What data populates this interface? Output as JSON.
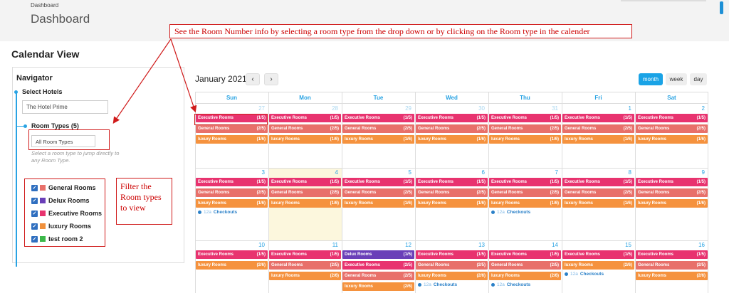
{
  "header": {
    "breadcrumb": "Dashboard",
    "title": "Dashboard"
  },
  "callouts": {
    "top": "See the Room Number info by selecting a room type from the drop down or by clicking on the Room type in the calender",
    "side": "Filter the Room types to view"
  },
  "calendar_view": {
    "title": "Calendar View"
  },
  "navigator": {
    "title": "Navigator",
    "select_hotels_label": "Select Hotels",
    "hotel_value": "The Hotel Prime",
    "room_types_label": "Room Types (5)",
    "room_types_select": "All Room Types",
    "hint": "Select a room type to jump directly to any Room Type.",
    "filters": [
      {
        "label": "General Rooms",
        "color": "#e8706a"
      },
      {
        "label": "Delux Rooms",
        "color": "#6a3fb8"
      },
      {
        "label": "Executive Rooms",
        "color": "#e8336f"
      },
      {
        "label": "luxury Rooms",
        "color": "#f0903c"
      },
      {
        "label": "test room 2",
        "color": "#3cb84a"
      }
    ]
  },
  "toolbar": {
    "month_label": "January 2021",
    "prev": "‹",
    "next": "›",
    "views": [
      "month",
      "week",
      "day"
    ],
    "active_view": "month"
  },
  "days": [
    "Sun",
    "Mon",
    "Tue",
    "Wed",
    "Thu",
    "Fri",
    "Sat"
  ],
  "event_types": {
    "E": {
      "label": "Executive Rooms",
      "color": "#e8336f"
    },
    "G": {
      "label": "General Rooms",
      "color": "#e8706a"
    },
    "L": {
      "label": "luxury Rooms",
      "color": "#f5923e"
    },
    "D": {
      "label": "Delux Rooms",
      "color": "#6a3fb8"
    }
  },
  "checkout": {
    "time": "12a",
    "label": "Checkouts"
  },
  "weeks": [
    {
      "cells": [
        {
          "day": "27",
          "other": true,
          "events": [
            [
              "E",
              "(1/5)"
            ],
            [
              "G",
              "(2/5)"
            ],
            [
              "L",
              "(1/6)"
            ]
          ]
        },
        {
          "day": "28",
          "other": true,
          "events": [
            [
              "E",
              "(1/5)"
            ],
            [
              "G",
              "(2/5)"
            ],
            [
              "L",
              "(1/6)"
            ]
          ]
        },
        {
          "day": "29",
          "other": true,
          "events": [
            [
              "E",
              "(1/5)"
            ],
            [
              "G",
              "(2/5)"
            ],
            [
              "L",
              "(1/6)"
            ]
          ]
        },
        {
          "day": "30",
          "other": true,
          "events": [
            [
              "E",
              "(1/5)"
            ],
            [
              "G",
              "(2/5)"
            ],
            [
              "L",
              "(1/6)"
            ]
          ]
        },
        {
          "day": "31",
          "other": true,
          "events": [
            [
              "E",
              "(1/5)"
            ],
            [
              "G",
              "(2/5)"
            ],
            [
              "L",
              "(1/6)"
            ]
          ]
        },
        {
          "day": "1",
          "events": [
            [
              "E",
              "(1/5)"
            ],
            [
              "G",
              "(2/5)"
            ],
            [
              "L",
              "(1/6)"
            ]
          ]
        },
        {
          "day": "2",
          "events": [
            [
              "E",
              "(1/5)"
            ],
            [
              "G",
              "(2/5)"
            ],
            [
              "L",
              "(1/6)"
            ]
          ]
        }
      ]
    },
    {
      "cells": [
        {
          "day": "3",
          "events": [
            [
              "E",
              "(1/5)"
            ],
            [
              "G",
              "(2/5)"
            ],
            [
              "L",
              "(1/6)"
            ]
          ],
          "checkout": true
        },
        {
          "day": "4",
          "today": true,
          "events": [
            [
              "E",
              "(1/5)"
            ],
            [
              "G",
              "(2/5)"
            ],
            [
              "L",
              "(1/6)"
            ]
          ]
        },
        {
          "day": "5",
          "events": [
            [
              "E",
              "(1/5)"
            ],
            [
              "G",
              "(2/5)"
            ],
            [
              "L",
              "(1/6)"
            ]
          ]
        },
        {
          "day": "6",
          "events": [
            [
              "E",
              "(1/5)"
            ],
            [
              "G",
              "(2/5)"
            ],
            [
              "L",
              "(1/6)"
            ]
          ]
        },
        {
          "day": "7",
          "events": [
            [
              "E",
              "(1/5)"
            ],
            [
              "G",
              "(2/5)"
            ],
            [
              "L",
              "(1/6)"
            ]
          ],
          "checkout": true
        },
        {
          "day": "8",
          "events": [
            [
              "E",
              "(1/5)"
            ],
            [
              "G",
              "(2/5)"
            ],
            [
              "L",
              "(1/6)"
            ]
          ]
        },
        {
          "day": "9",
          "events": [
            [
              "E",
              "(1/5)"
            ],
            [
              "G",
              "(2/5)"
            ],
            [
              "L",
              "(1/6)"
            ]
          ]
        }
      ]
    },
    {
      "cells": [
        {
          "day": "10",
          "events": [
            [
              "E",
              "(1/5)"
            ],
            [
              "L",
              "(2/6)"
            ]
          ]
        },
        {
          "day": "11",
          "events": [
            [
              "E",
              "(1/5)"
            ],
            [
              "G",
              "(2/5)"
            ],
            [
              "L",
              "(2/6)"
            ]
          ]
        },
        {
          "day": "12",
          "events": [
            [
              "D",
              "(1/5)"
            ],
            [
              "E",
              "(2/5)"
            ],
            [
              "G",
              "(2/5)"
            ],
            [
              "L",
              "(2/6)"
            ]
          ]
        },
        {
          "day": "13",
          "events": [
            [
              "E",
              "(1/5)"
            ],
            [
              "G",
              "(2/5)"
            ],
            [
              "L",
              "(2/6)"
            ]
          ],
          "checkout": true
        },
        {
          "day": "14",
          "events": [
            [
              "E",
              "(1/5)"
            ],
            [
              "G",
              "(2/5)"
            ],
            [
              "L",
              "(2/6)"
            ]
          ],
          "checkout": true
        },
        {
          "day": "15",
          "events": [
            [
              "E",
              "(1/5)"
            ],
            [
              "L",
              "(2/6)"
            ]
          ],
          "checkout": true
        },
        {
          "day": "16",
          "events": [
            [
              "E",
              "(1/5)"
            ],
            [
              "G",
              "(2/5)"
            ],
            [
              "L",
              "(2/6)"
            ]
          ]
        }
      ]
    }
  ]
}
